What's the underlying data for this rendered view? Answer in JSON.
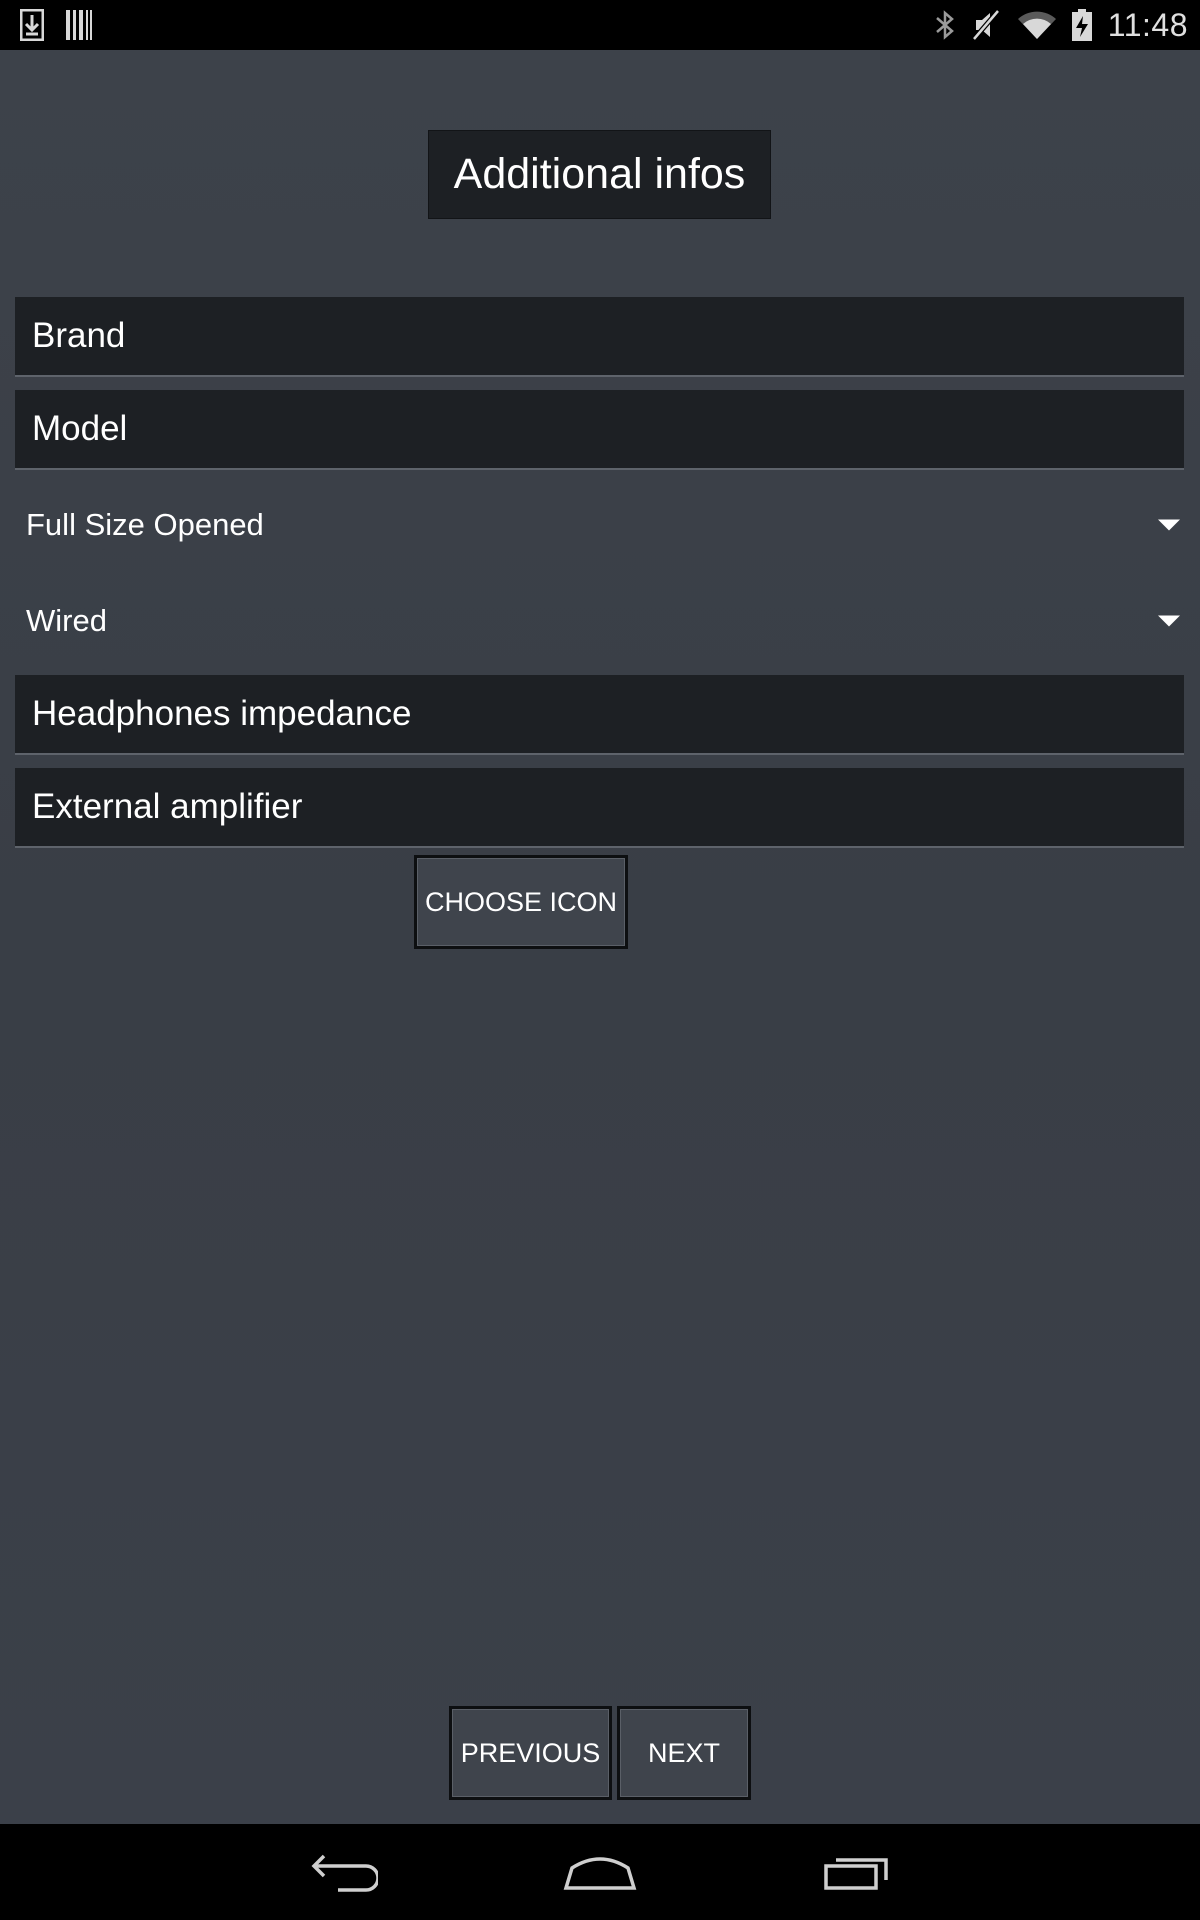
{
  "status_bar": {
    "time": "11:48",
    "left_icons": [
      "download-icon",
      "barcode-icon"
    ],
    "right_icons": [
      "bluetooth-icon",
      "vibrate-mute-icon",
      "wifi-icon",
      "battery-charging-icon"
    ]
  },
  "page": {
    "title": "Additional infos"
  },
  "form": {
    "brand_placeholder": "Brand",
    "model_placeholder": "Model",
    "size_selected": "Full Size Opened",
    "connection_selected": "Wired",
    "impedance_placeholder": "Headphones impedance",
    "amplifier_placeholder": "External amplifier",
    "choose_icon_label": "CHOOSE ICON"
  },
  "footer": {
    "previous_label": "PREVIOUS",
    "next_label": "NEXT"
  },
  "nav_bar": {
    "icons": [
      "back-icon",
      "home-icon",
      "recent-apps-icon"
    ]
  }
}
